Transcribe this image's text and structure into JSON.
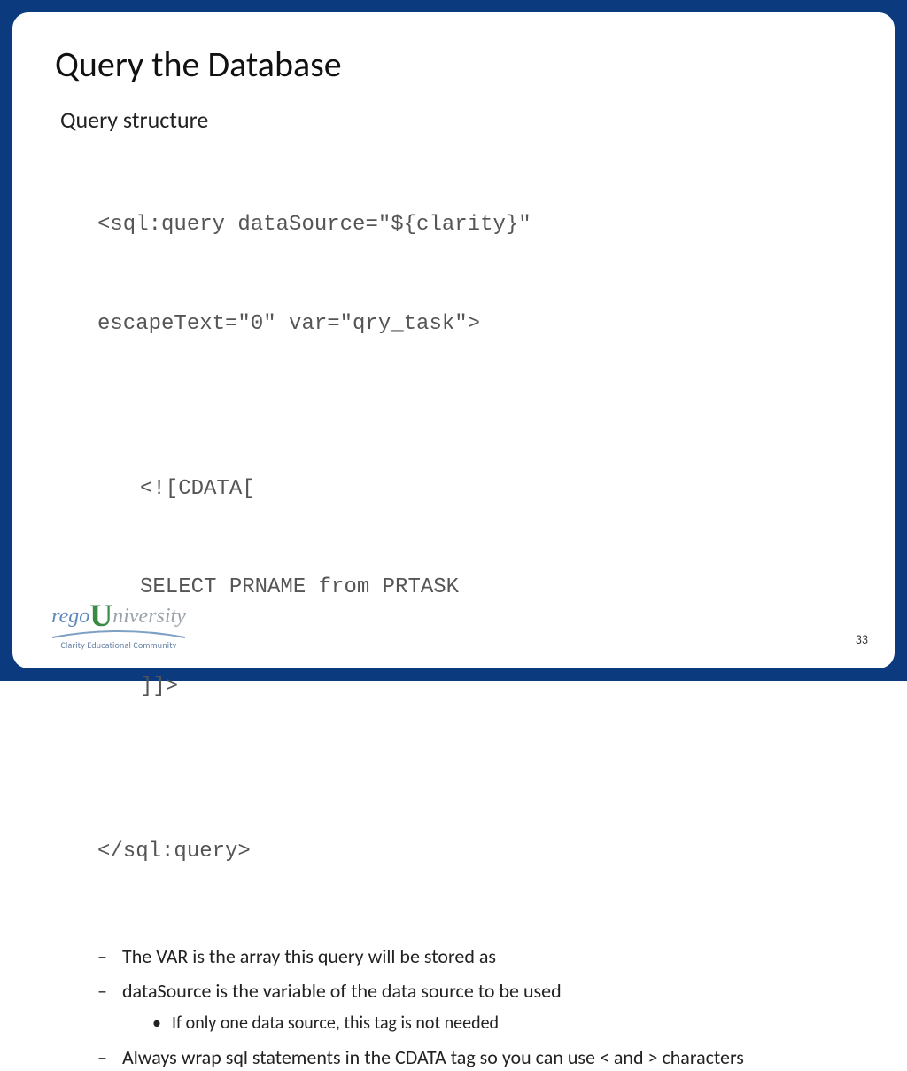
{
  "title": "Query the Database",
  "subtitle": "Query structure",
  "code": {
    "open1": "<sql:query dataSource=\"${clarity}\"",
    "open2": "escapeText=\"0\" var=\"qry_task\">",
    "l1": "<![CDATA[",
    "l2": "SELECT PRNAME from PRTASK",
    "l3": "]]>",
    "close": "</sql:query>"
  },
  "bullets": {
    "b1": "The VAR is the array this query will be stored as",
    "b2": "dataSource is the variable of the data source to be used",
    "b2_sub1": "If only one data source, this tag is not needed",
    "b3": "Always wrap sql statements in the CDATA tag so you can use < and > characters"
  },
  "page_number": "33",
  "logo": {
    "rego": "rego",
    "u": "U",
    "niversity": "niversity",
    "tagline": "Clarity Educational Community"
  }
}
